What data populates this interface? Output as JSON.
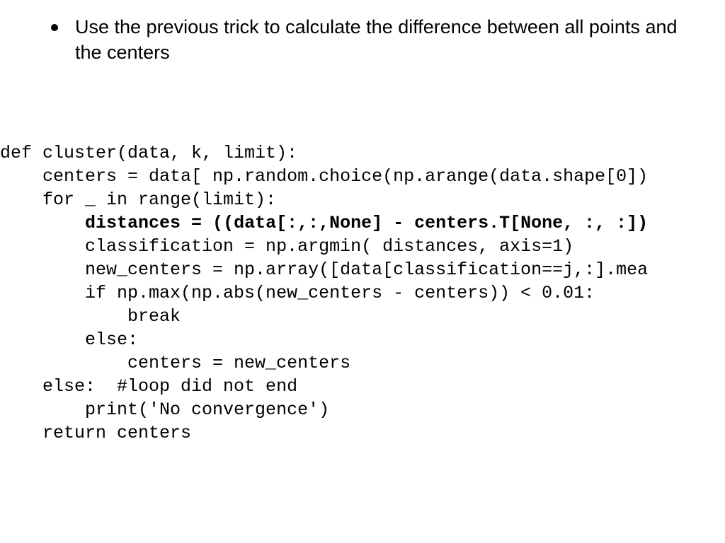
{
  "bullet": {
    "text": "Use the previous trick to calculate the difference between all points and the centers"
  },
  "code": {
    "l1": "def cluster(data, k, limit):",
    "l2": "    centers = data[ np.random.choice(np.arange(data.shape[0])",
    "l3": "    for _ in range(limit):",
    "l4a": "        ",
    "l4b": "distances = ((data[:,:,None] - centers.T[None, :, :])",
    "l5": "        classification = np.argmin( distances, axis=1)",
    "l6": "        new_centers = np.array([data[classification==j,:].mea",
    "l7": "        if np.max(np.abs(new_centers - centers)) < 0.01:",
    "l8": "            break",
    "l9": "        else:",
    "l10": "            centers = new_centers",
    "l11": "    else:  #loop did not end",
    "l12": "        print('No convergence')",
    "l13": "    return centers"
  }
}
